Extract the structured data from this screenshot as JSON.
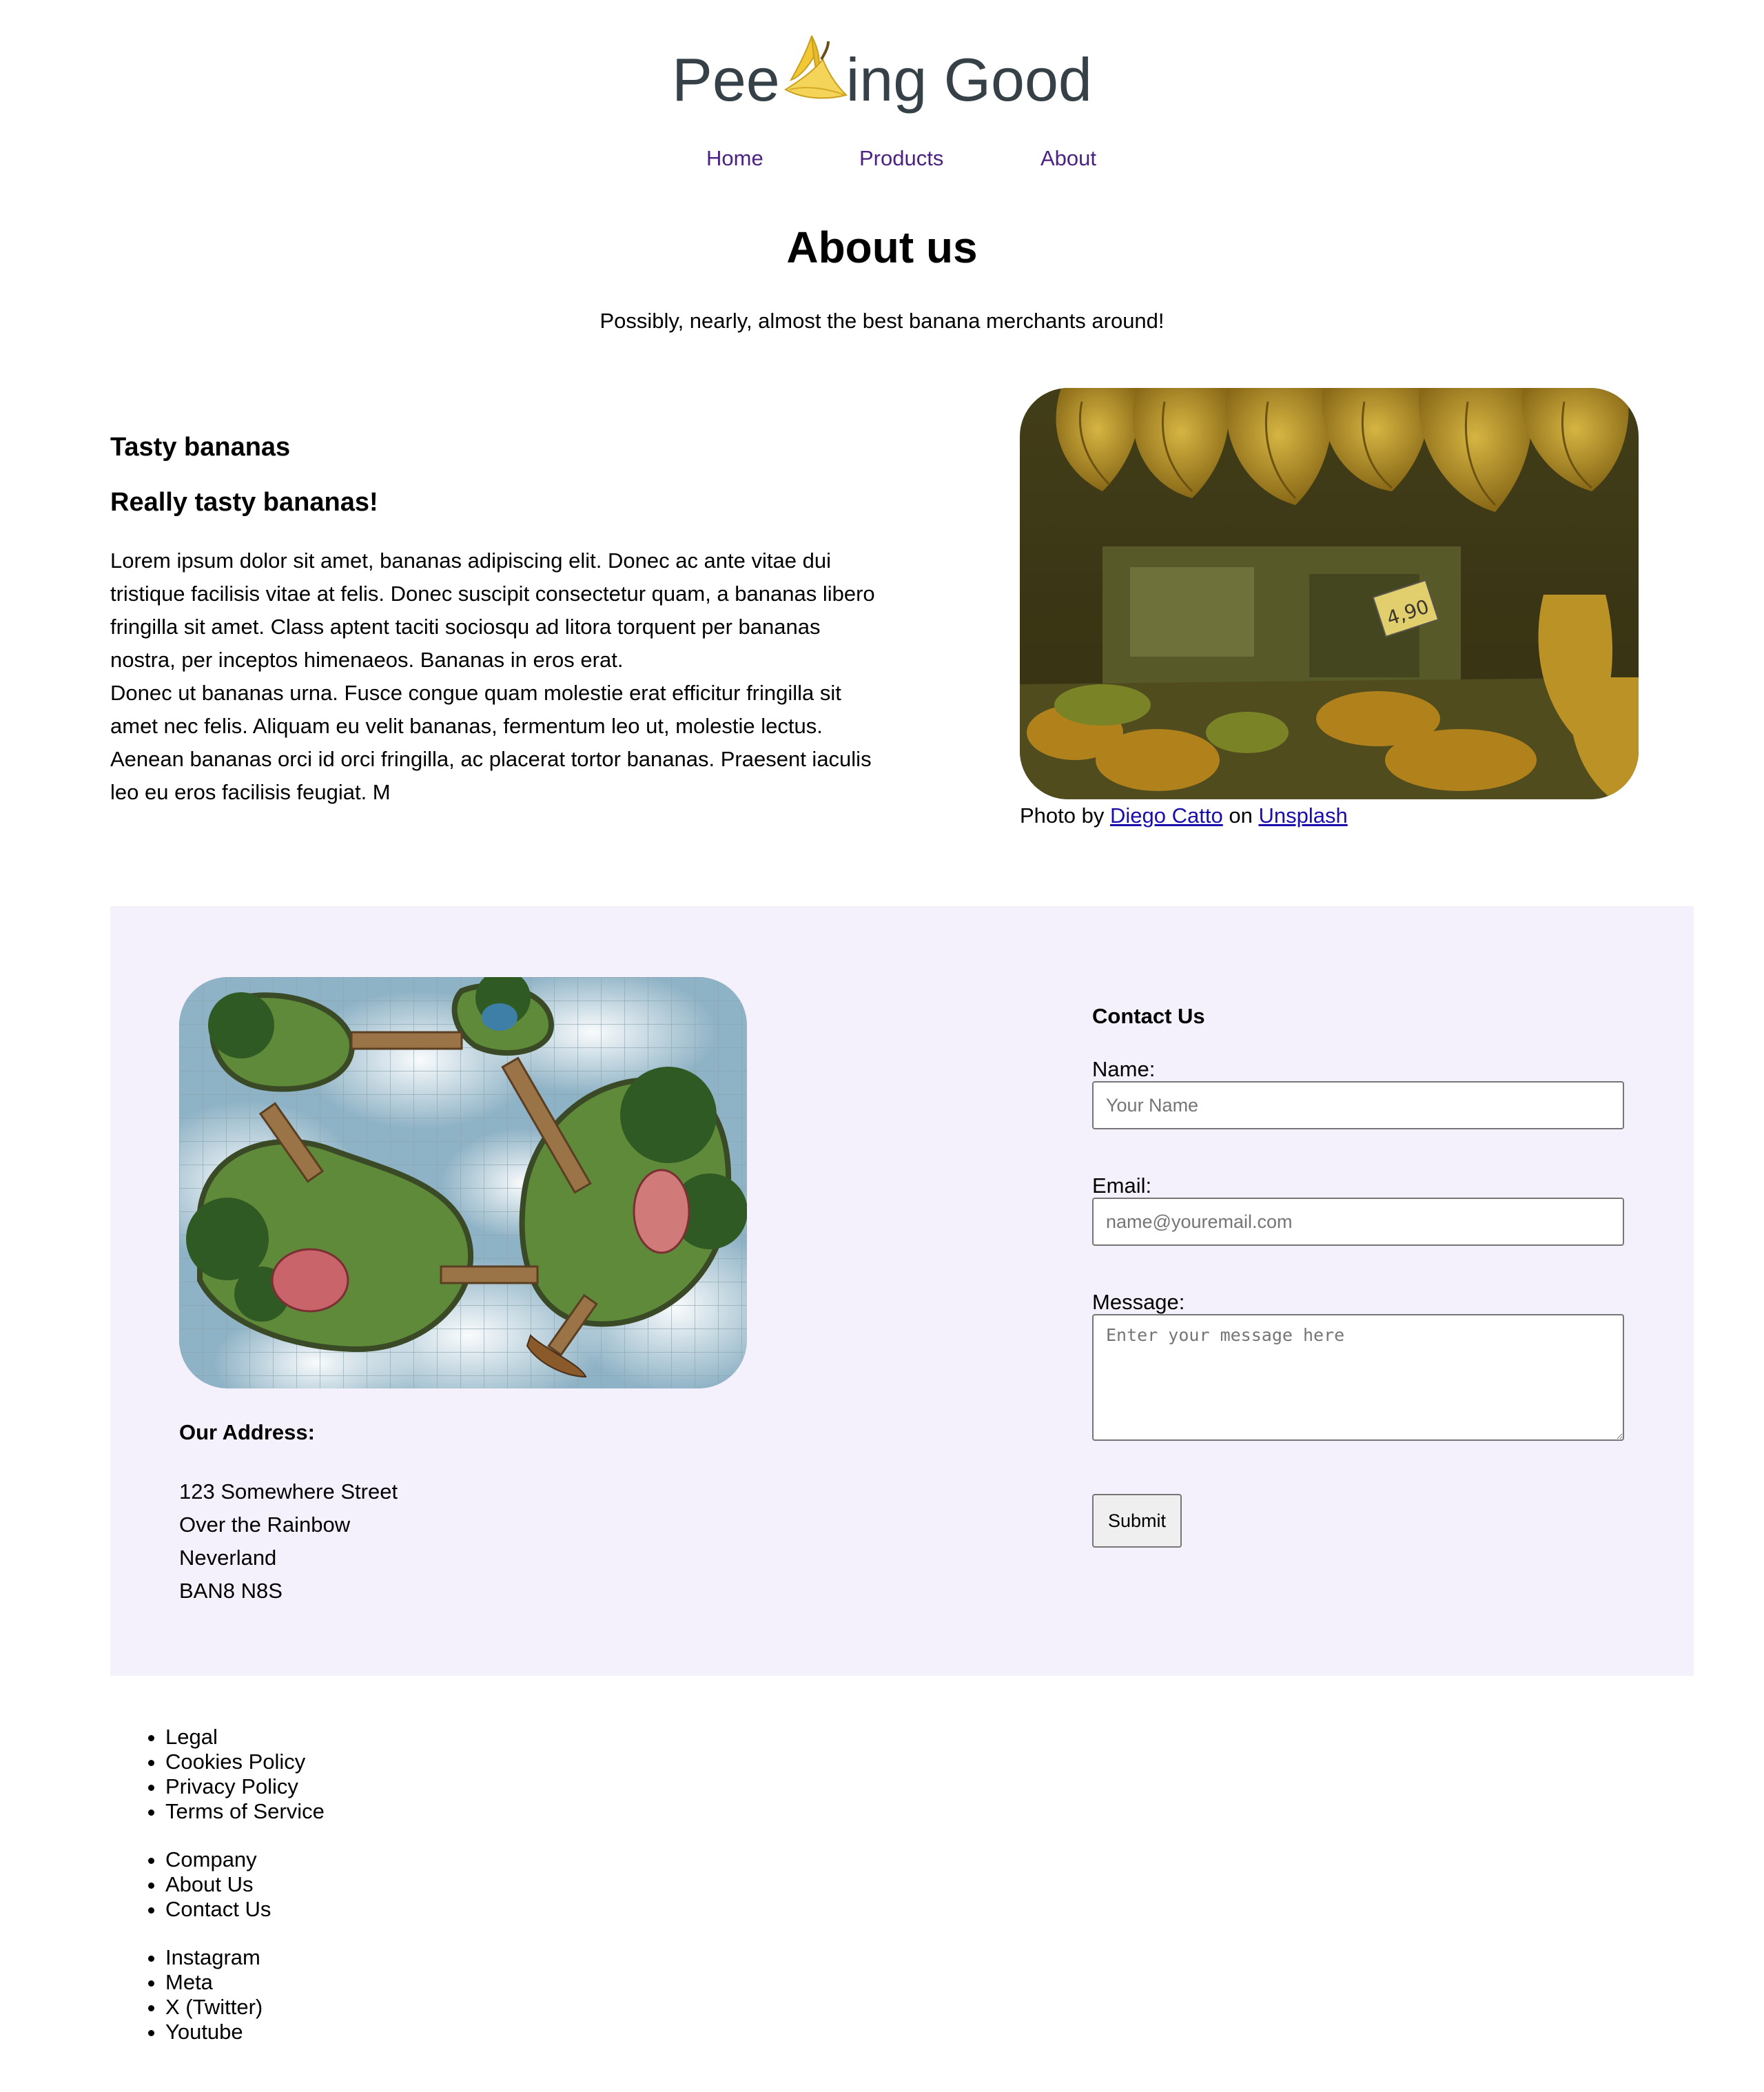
{
  "brand": {
    "name_part1": "Pee",
    "name_part2": "ing Good"
  },
  "nav": {
    "home": "Home",
    "products": "Products",
    "about": "About"
  },
  "page": {
    "title": "About us",
    "tagline": "Possibly, nearly, almost the best banana merchants around!"
  },
  "intro": {
    "heading": "Tasty bananas",
    "subheading": "Really tasty bananas!",
    "paragraph1": "Lorem ipsum dolor sit amet, bananas adipiscing elit. Donec ac ante vitae dui tristique facilisis vitae at felis. Donec suscipit consectetur quam, a bananas libero fringilla sit amet. Class aptent taciti sociosqu ad litora torquent per bananas nostra, per inceptos himenaeos. Bananas in eros erat.",
    "paragraph2": "Donec ut bananas urna. Fusce congue quam molestie erat efficitur fringilla sit amet nec felis. Aliquam eu velit bananas, fermentum leo ut, molestie lectus. Aenean bananas orci id orci fringilla, ac placerat tortor bananas. Praesent iaculis leo eu eros facilisis feugiat. M"
  },
  "photo_credit": {
    "prefix": "Photo by",
    "author": "Diego Catto",
    "middle": "on",
    "site": "Unsplash",
    "price_tag": "4,90"
  },
  "address": {
    "title": "Our Address:",
    "line1": "123 Somewhere Street",
    "line2": "Over the Rainbow",
    "line3": "Neverland",
    "line4": "BAN8 N8S"
  },
  "contact": {
    "title": "Contact Us",
    "name_label": "Name:",
    "name_placeholder": "Your Name",
    "email_label": "Email:",
    "email_placeholder": "name@youremail.com",
    "message_label": "Message:",
    "message_placeholder": "Enter your message here",
    "submit_label": "Submit"
  },
  "footer": {
    "legal": [
      "Legal",
      "Cookies Policy",
      "Privacy Policy",
      "Terms of Service"
    ],
    "company": [
      "Company",
      "About Us",
      "Contact Us"
    ],
    "social": [
      "Instagram",
      "Meta",
      "X (Twitter)",
      "Youtube"
    ]
  },
  "colors": {
    "logo_text": "#354047",
    "nav_link": "#4b2184",
    "link": "#1a0dab",
    "panel_bg": "#f4f1fc",
    "banana": "#f2c935"
  },
  "icons": {
    "logo": "banana-icon"
  }
}
